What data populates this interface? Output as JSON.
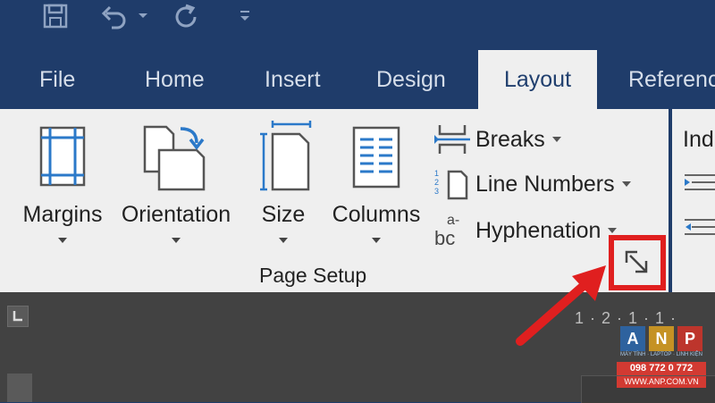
{
  "quick_access": {
    "save_icon": "save-icon",
    "undo_icon": "undo-icon",
    "redo_icon": "repeat-icon",
    "customize_icon": "customize-qat-icon"
  },
  "tabs": [
    {
      "label": "File"
    },
    {
      "label": "Home"
    },
    {
      "label": "Insert"
    },
    {
      "label": "Design"
    },
    {
      "label": "Layout",
      "active": true
    },
    {
      "label": "Referenc"
    }
  ],
  "page_setup": {
    "margins": "Margins",
    "orientation": "Orientation",
    "size": "Size",
    "columns": "Columns",
    "breaks": "Breaks",
    "line_numbers": "Line Numbers",
    "hyphenation": "Hyphenation",
    "hyphenation_icon_text": {
      "top": "a-",
      "bottom": "bc"
    },
    "group_label": "Page Setup"
  },
  "indent_group": {
    "label_partial": "Ind"
  },
  "ruler": {
    "text": "1 · 2 · 1 · 1 ·"
  },
  "watermark": {
    "letters": [
      "A",
      "N",
      "P"
    ],
    "tagline": "MÁY TÍNH · LAPTOP · LINH KIỆN",
    "phone": "098 772 0 772",
    "site": "WWW.ANP.COM.VN"
  },
  "colors": {
    "titlebar": "#1f3c6a",
    "ribbon": "#efefef",
    "highlight": "#e01f1f",
    "icon_blue": "#2b79c9",
    "document": "#424242"
  }
}
